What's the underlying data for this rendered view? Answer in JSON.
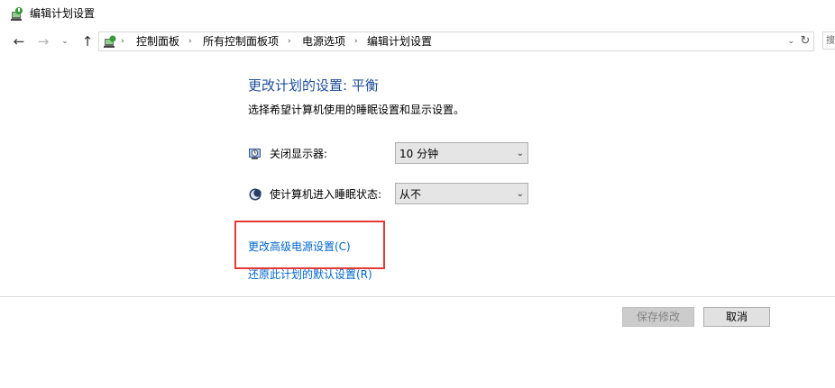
{
  "window": {
    "title": "编辑计划设置"
  },
  "nav": {
    "back_glyph": "←",
    "forward_glyph": "→",
    "recent_glyph": "⌄",
    "up_glyph": "↑",
    "breadcrumbs": [
      "控制面板",
      "所有控制面板项",
      "电源选项",
      "编辑计划设置"
    ],
    "separator": "›",
    "dropdown_glyph": "⌄",
    "refresh_glyph": "↻",
    "search_partial_text": "搜"
  },
  "main": {
    "heading": "更改计划的设置: 平衡",
    "subtitle": "选择希望计算机使用的睡眠设置和显示设置。",
    "display_off": {
      "label": "关闭显示器:",
      "value": "10 分钟",
      "icon": "monitor-clock-icon"
    },
    "sleep": {
      "label": "使计算机进入睡眠状态:",
      "value": "从不",
      "icon": "moon-sleep-icon"
    },
    "advanced_link": "更改高级电源设置(C)",
    "restore_link": "还原此计划的默认设置(R)"
  },
  "footer": {
    "save_label": "保存修改",
    "cancel_label": "取消"
  },
  "colors": {
    "heading": "#1e4e9a",
    "link": "#0066cc",
    "highlight": "#e53935",
    "save_disabled_bg": "#cccccc"
  }
}
